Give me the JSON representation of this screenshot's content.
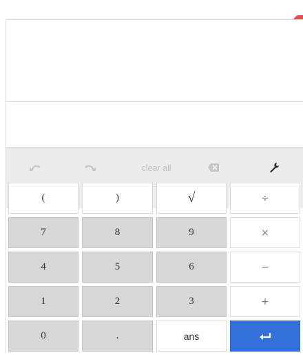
{
  "window": {
    "close_glyph": "×"
  },
  "toolbar": {
    "undo_icon": "undo-icon",
    "redo_icon": "redo-icon",
    "clear_label": "clear all",
    "backspace_icon": "backspace-icon",
    "settings_icon": "wrench-icon"
  },
  "keys": {
    "row1": [
      "(",
      ")",
      "√",
      "÷"
    ],
    "row2": [
      "7",
      "8",
      "9",
      "×"
    ],
    "row3": [
      "4",
      "5",
      "6",
      "−"
    ],
    "row4": [
      "1",
      "2",
      "3",
      "+"
    ],
    "row5": [
      "0",
      ".",
      "ans",
      "↵"
    ]
  },
  "colors": {
    "enter": "#3470da",
    "close": "#e0524d",
    "numeric_key": "#d7d7d7",
    "toolbar": "#ececec"
  }
}
